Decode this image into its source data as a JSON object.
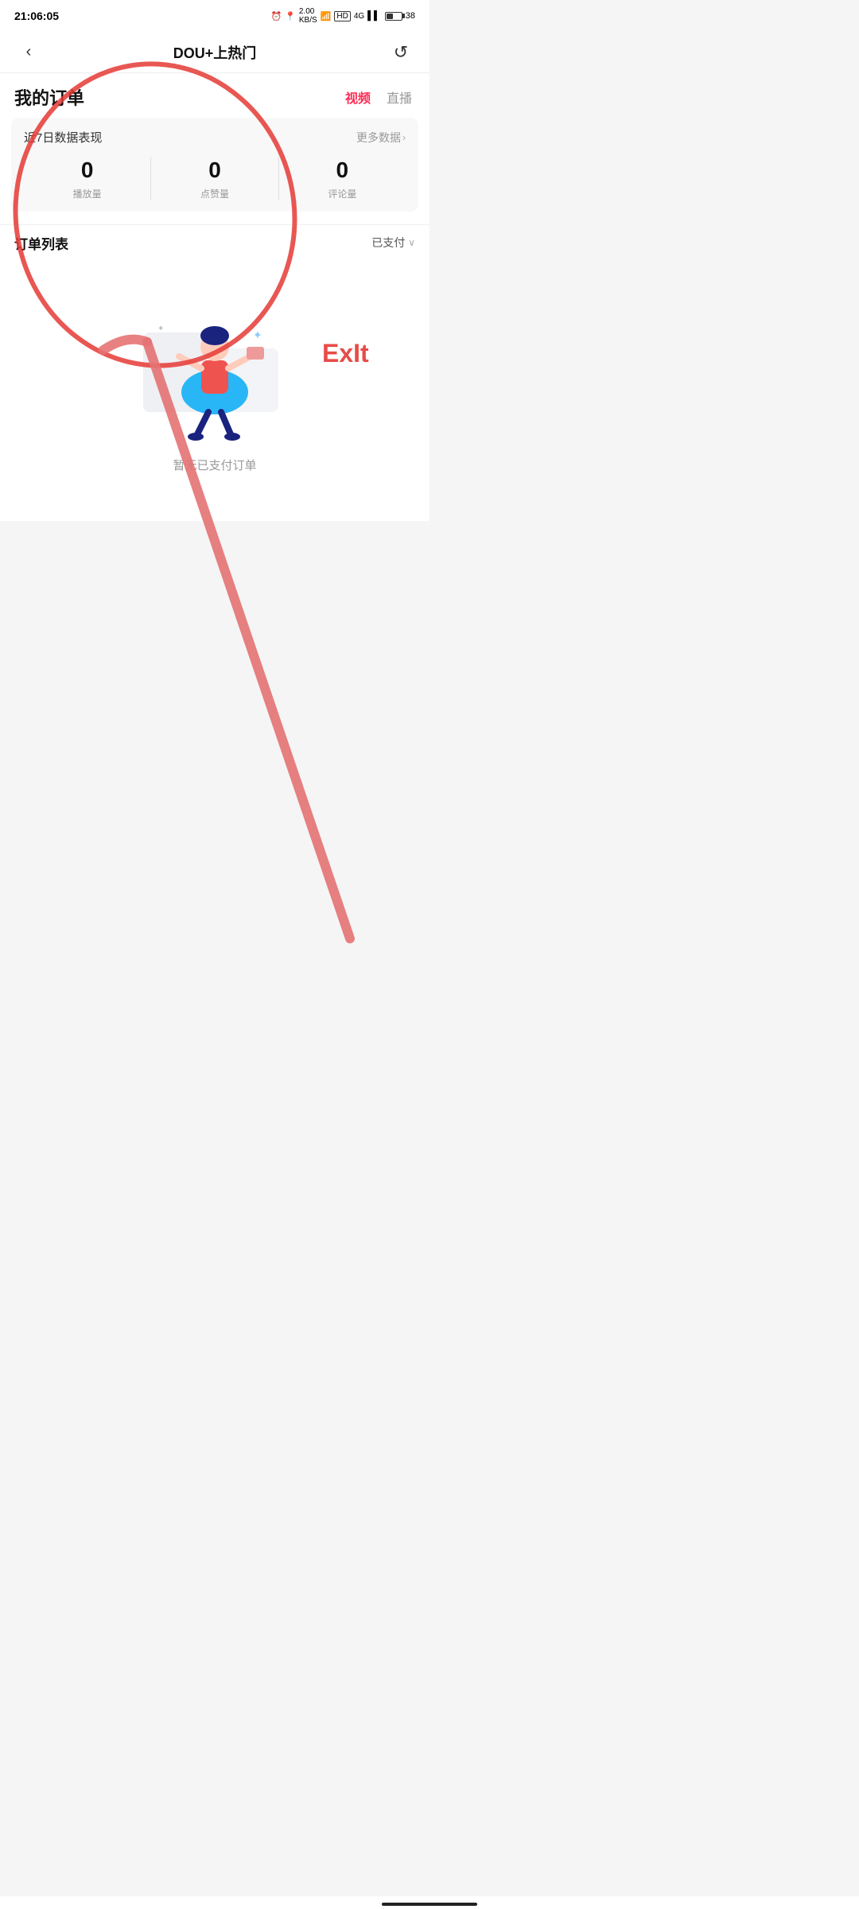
{
  "statusBar": {
    "time": "21:06:05",
    "battery": "38",
    "signal": "4G"
  },
  "navBar": {
    "backLabel": "‹",
    "title": "DOU+上热门",
    "refreshIcon": "↺"
  },
  "header": {
    "myOrdersLabel": "我的订单",
    "tabs": [
      {
        "label": "视频",
        "active": true
      },
      {
        "label": "直播",
        "active": false
      }
    ]
  },
  "statsCard": {
    "title": "近7日数据表现",
    "moreLabel": "更多数据",
    "stats": [
      {
        "value": "0",
        "label": "播放量"
      },
      {
        "value": "0",
        "label": "点赞量"
      },
      {
        "value": "0",
        "label": "评论量"
      }
    ]
  },
  "orderList": {
    "title": "订单列表",
    "filterLabel": "已支付",
    "emptyText": "暂无已支付订单"
  },
  "annotation": {
    "circleLabel": "circle around 我的订单 and stats",
    "exitLabel": "ExIt"
  }
}
